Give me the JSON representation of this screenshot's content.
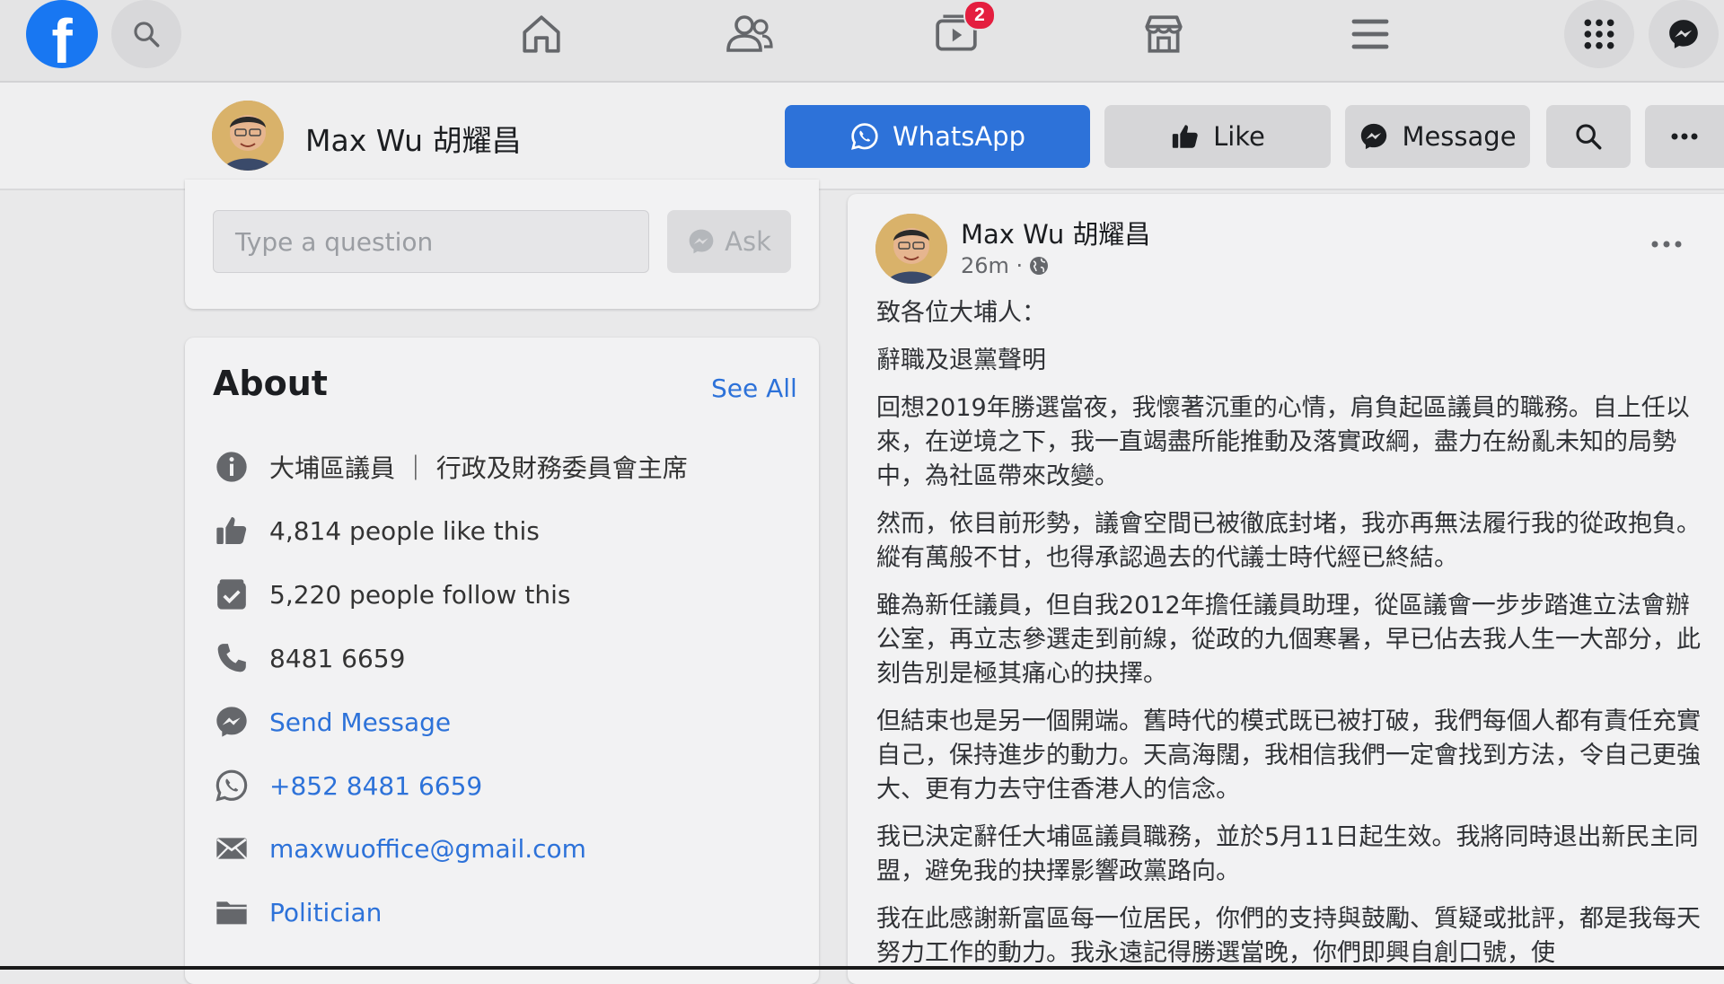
{
  "nav": {
    "video_badge": "2"
  },
  "page_header": {
    "name": "Max Wu 胡耀昌",
    "whatsapp_label": "WhatsApp",
    "like_label": "Like",
    "message_label": "Message"
  },
  "question": {
    "placeholder": "Type a question",
    "ask_label": "Ask"
  },
  "about": {
    "title": "About",
    "see_all": "See All",
    "items": [
      {
        "icon": "info-icon",
        "text": "大埔區議員 ｜ 行政及財務委員會主席"
      },
      {
        "icon": "thumbs-up-icon",
        "text": "4,814 people like this"
      },
      {
        "icon": "follow-icon",
        "text": "5,220 people follow this"
      },
      {
        "icon": "phone-icon",
        "text": "8481 6659"
      },
      {
        "icon": "messenger-icon",
        "text": "Send Message"
      },
      {
        "icon": "whatsapp-icon",
        "text": "+852 8481 6659"
      },
      {
        "icon": "email-icon",
        "text": "maxwuoffice@gmail.com"
      },
      {
        "icon": "category-icon",
        "text": "Politician"
      }
    ]
  },
  "post": {
    "author": "Max Wu 胡耀昌",
    "time": "26m ·",
    "paragraphs": [
      "致各位大埔人：",
      "辭職及退黨聲明",
      "回想2019年勝選當夜，我懷著沉重的心情，肩負起區議員的職務。自上任以來，在逆境之下，我一直竭盡所能推動及落實政綱，盡力在紛亂未知的局勢中，為社區帶來改變。",
      "然而，依目前形勢，議會空間已被徹底封堵，我亦再無法履行我的從政抱負。縱有萬般不甘，也得承認過去的代議士時代經已終結。",
      "雖為新任議員，但自我2012年擔任議員助理，從區議會一步步踏進立法會辦公室，再立志參選走到前線，從政的九個寒暑，早已佔去我人生一大部分，此刻告別是極其痛心的抉擇。",
      "但結束也是另一個開端。舊時代的模式既已被打破，我們每個人都有責任充實自己，保持進步的動力。天高海闊，我相信我們一定會找到方法，令自己更強大、更有力去守住香港人的信念。",
      "我已決定辭任大埔區議員職務，並於5月11日起生效。我將同時退出新民主同盟，避免我的抉擇影響政黨路向。",
      "我在此感謝新富區每一位居民，你們的支持與鼓勵、質疑或批評，都是我每天努力工作的動力。我永遠記得勝選當晚，你們即興自創口號，使"
    ]
  },
  "colors": {
    "brand": "#1877f2",
    "whatsapp_button": "#2d72d9",
    "link": "#2d72d9",
    "badge": "#e41e3f"
  }
}
